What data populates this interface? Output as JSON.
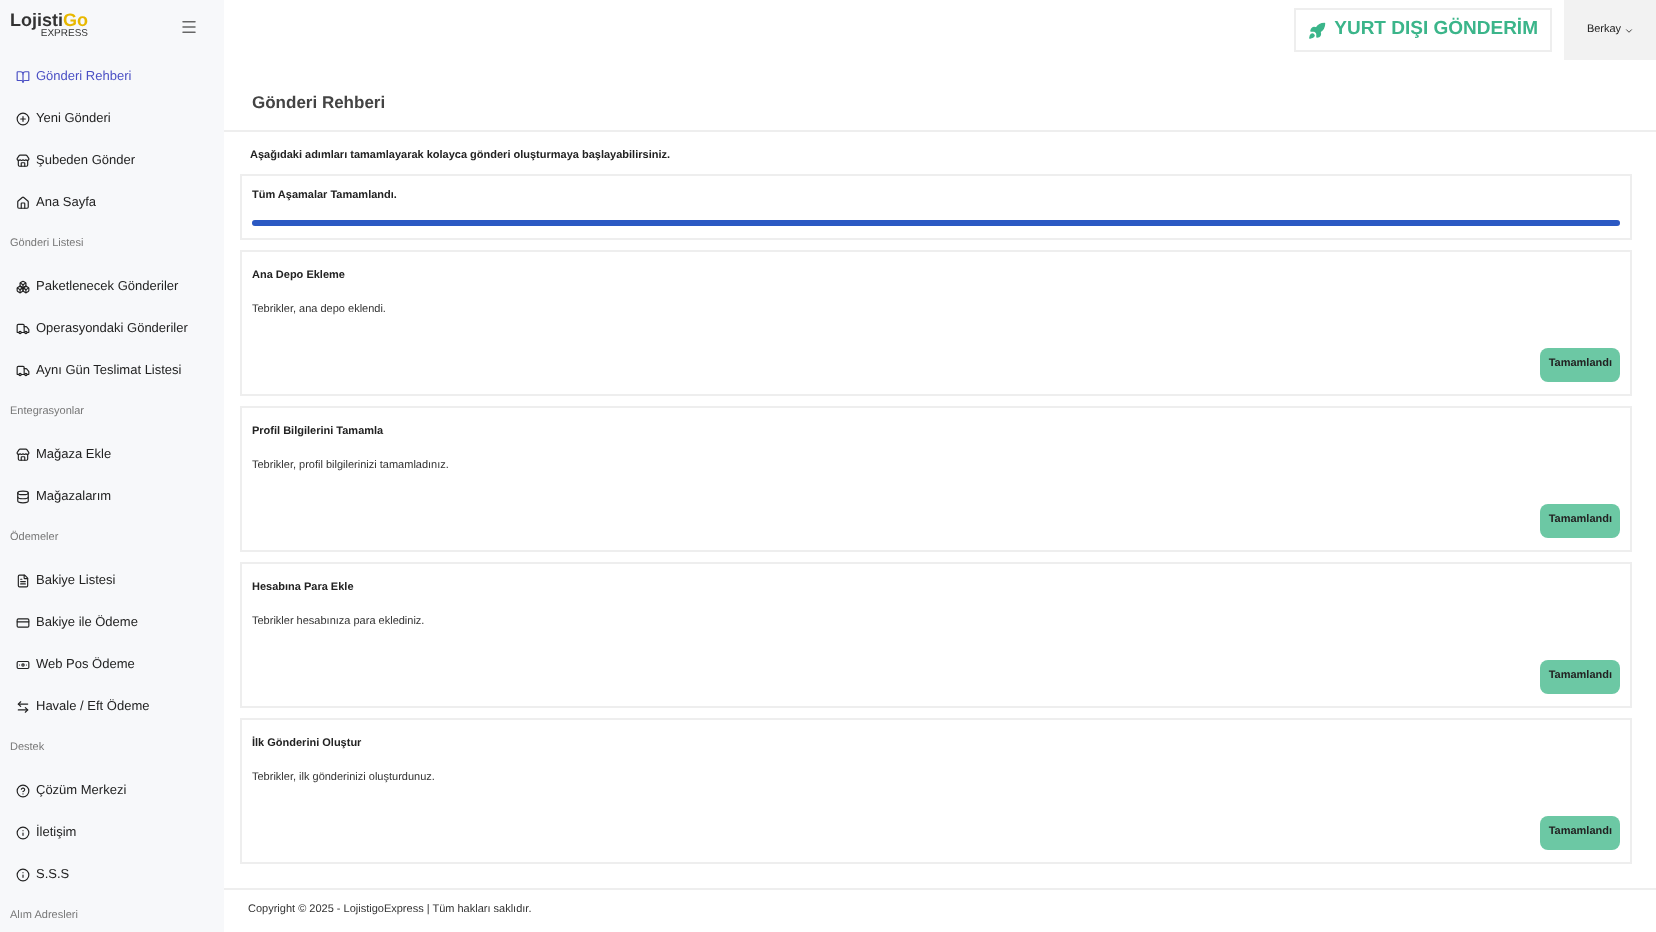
{
  "logo": {
    "text": "Lojisti",
    "accent": "Go",
    "tagline": "EXPRESS"
  },
  "sidebar": {
    "groups": [
      {
        "items": [
          {
            "label": "Gönderi Rehberi",
            "selected": true
          },
          {
            "label": "Yeni Gönderi",
            "selected": false
          },
          {
            "label": "Şubeden Gönder",
            "selected": false
          },
          {
            "label": "Ana Sayfa",
            "selected": false
          }
        ]
      },
      {
        "title": "Gönderi Listesi",
        "items": [
          {
            "label": "Paketlenecek Gönderiler",
            "selected": false
          },
          {
            "label": "Operasyondaki Gönderiler",
            "selected": false
          },
          {
            "label": "Aynı Gün Teslimat Listesi",
            "selected": false
          }
        ]
      },
      {
        "title": "Entegrasyonlar",
        "items": [
          {
            "label": "Mağaza Ekle",
            "selected": false
          },
          {
            "label": "Mağazalarım",
            "selected": false
          }
        ]
      },
      {
        "title": "Ödemeler",
        "items": [
          {
            "label": "Bakiye Listesi",
            "selected": false
          },
          {
            "label": "Bakiye ile Ödeme",
            "selected": false
          },
          {
            "label": "Web Pos Ödeme",
            "selected": false
          },
          {
            "label": "Havale / Eft Ödeme",
            "selected": false
          }
        ]
      },
      {
        "title": "Destek",
        "items": [
          {
            "label": "Çözüm Merkezi",
            "selected": false
          },
          {
            "label": "İletişim",
            "selected": false
          },
          {
            "label": "S.S.S",
            "selected": false
          }
        ]
      },
      {
        "title": "Alım Adresleri"
      }
    ]
  },
  "topbar": {
    "action": "YURT DIŞI GÖNDERİM",
    "user": "Berkay"
  },
  "page": {
    "title": "Gönderi Rehberi",
    "intro": "Aşağıdaki adımları tamamlayarak kolayca gönderi oluşturmaya başlayabilirsiniz.",
    "progress": {
      "label": "Tüm Aşamalar Tamamlandı.",
      "level": 1
    }
  },
  "steps": [
    {
      "title": "Ana Depo Ekleme",
      "text": "Tebrikler, ana depo eklendi.",
      "button": "Tamamlandı"
    },
    {
      "title": "Profil Bilgilerini Tamamla",
      "text": "Tebrikler, profil bilgilerinizi tamamladınız.",
      "button": "Tamamlandı"
    },
    {
      "title": "Hesabına Para Ekle",
      "text": "Tebrikler hesabınıza para eklediniz.",
      "button": "Tamamlandı"
    },
    {
      "title": "İlk Gönderini Oluştur",
      "text": "Tebrikler, ilk gönderinizi oluşturdunuz.",
      "button": "Tamamlandı"
    }
  ],
  "footer": "Copyright © 2025 - LojistigoExpress | Tüm hakları saklıdır."
}
